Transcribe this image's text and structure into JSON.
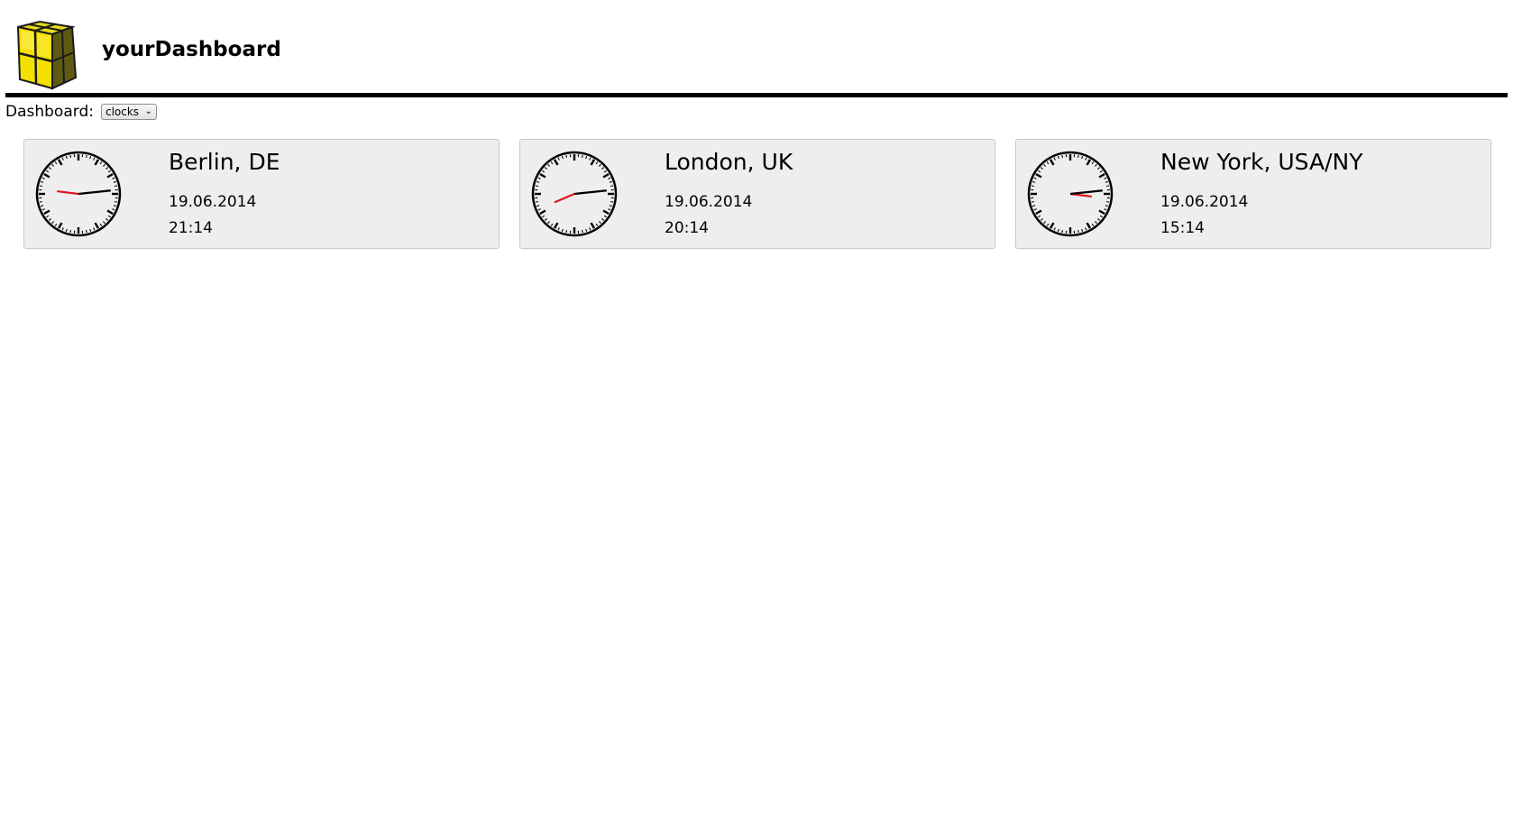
{
  "header": {
    "title": "yourDashboard",
    "logo_icon": "yellow-cube-icon"
  },
  "dashboard_selector": {
    "label": "Dashboard:",
    "selected": "clocks"
  },
  "clocks": [
    {
      "city": "Berlin, DE",
      "date": "19.06.2014",
      "time": "21:14"
    },
    {
      "city": "London, UK",
      "date": "19.06.2014",
      "time": "20:14"
    },
    {
      "city": "New York, USA/NY",
      "date": "19.06.2014",
      "time": "15:14"
    }
  ],
  "colors": {
    "hour_hand": "#e0161b",
    "minute_hand": "#000000",
    "card_background": "#eeeeee",
    "card_border": "#c8c8c8",
    "cube_yellow": "#f2de00"
  }
}
